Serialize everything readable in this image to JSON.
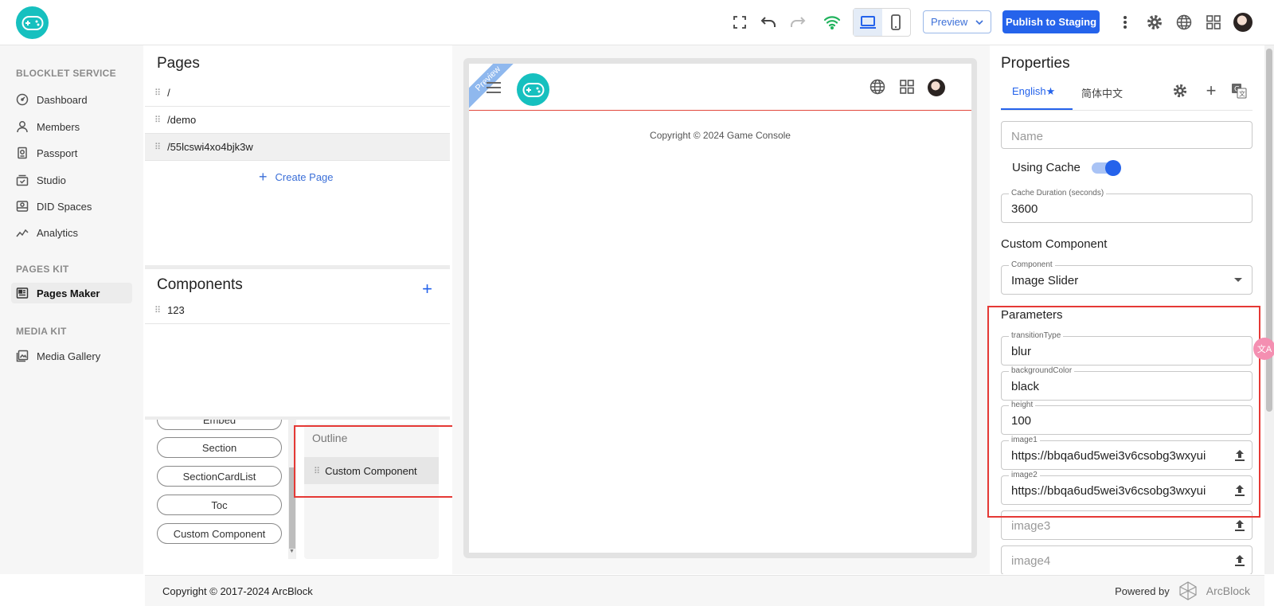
{
  "header": {
    "preview_label": "Preview",
    "publish_label": "Publish to Staging",
    "icons": [
      "fullscreen-icon",
      "undo-icon",
      "redo-icon",
      "wifi-icon",
      "desktop-icon",
      "mobile-icon",
      "more-vert-icon",
      "gear-icon",
      "globe-icon",
      "apps-icon"
    ],
    "accent": "#2563eb",
    "wifi_color": "#22b35e"
  },
  "sidebar": {
    "sections": [
      {
        "title": "BLOCKLET SERVICE",
        "items": [
          "Dashboard",
          "Members",
          "Passport",
          "Studio",
          "DID Spaces",
          "Analytics"
        ]
      },
      {
        "title": "PAGES KIT",
        "items": [
          "Pages Maker"
        ]
      },
      {
        "title": "MEDIA KIT",
        "items": [
          "Media Gallery"
        ]
      }
    ],
    "active_item": "Pages Maker"
  },
  "pages": {
    "title": "Pages",
    "items": [
      "/",
      "/demo",
      "/55lcswi4xo4bjk3w"
    ],
    "selected_index": 2,
    "create_label": "Create Page"
  },
  "components": {
    "title": "Components",
    "items": [
      "123"
    ]
  },
  "widgets": {
    "partial_top": "Embed",
    "items": [
      "Section",
      "SectionCardList",
      "Toc",
      "Custom Component"
    ]
  },
  "outline": {
    "title": "Outline",
    "items": [
      "Custom Component"
    ]
  },
  "canvas": {
    "ribbon": "Preview",
    "footer_text": "Copyright © 2024 Game Console",
    "header_border_color": "#e2483d"
  },
  "properties": {
    "title": "Properties",
    "tabs": [
      "English★",
      "简体中文"
    ],
    "active_tab": 0,
    "name_placeholder": "Name",
    "using_cache_label": "Using Cache",
    "using_cache_on": true,
    "cache_duration_label": "Cache Duration (seconds)",
    "cache_duration_value": "3600",
    "custom_component_label": "Custom Component",
    "component_label": "Component",
    "component_value": "Image Slider",
    "parameters_label": "Parameters",
    "params": [
      {
        "label": "transitionType",
        "value": "blur"
      },
      {
        "label": "backgroundColor",
        "value": "black"
      },
      {
        "label": "height",
        "value": "100"
      },
      {
        "label": "image1",
        "value": "https://bbqa6ud5wei3v6csobg3wxyui"
      },
      {
        "label": "image2",
        "value": "https://bbqa6ud5wei3v6csobg3wxyui"
      }
    ],
    "empty_params": [
      "image3",
      "image4"
    ]
  },
  "footer": {
    "copyright": "Copyright © 2017-2024  ArcBlock",
    "powered_by": "Powered by",
    "brand": "ArcBlock"
  }
}
